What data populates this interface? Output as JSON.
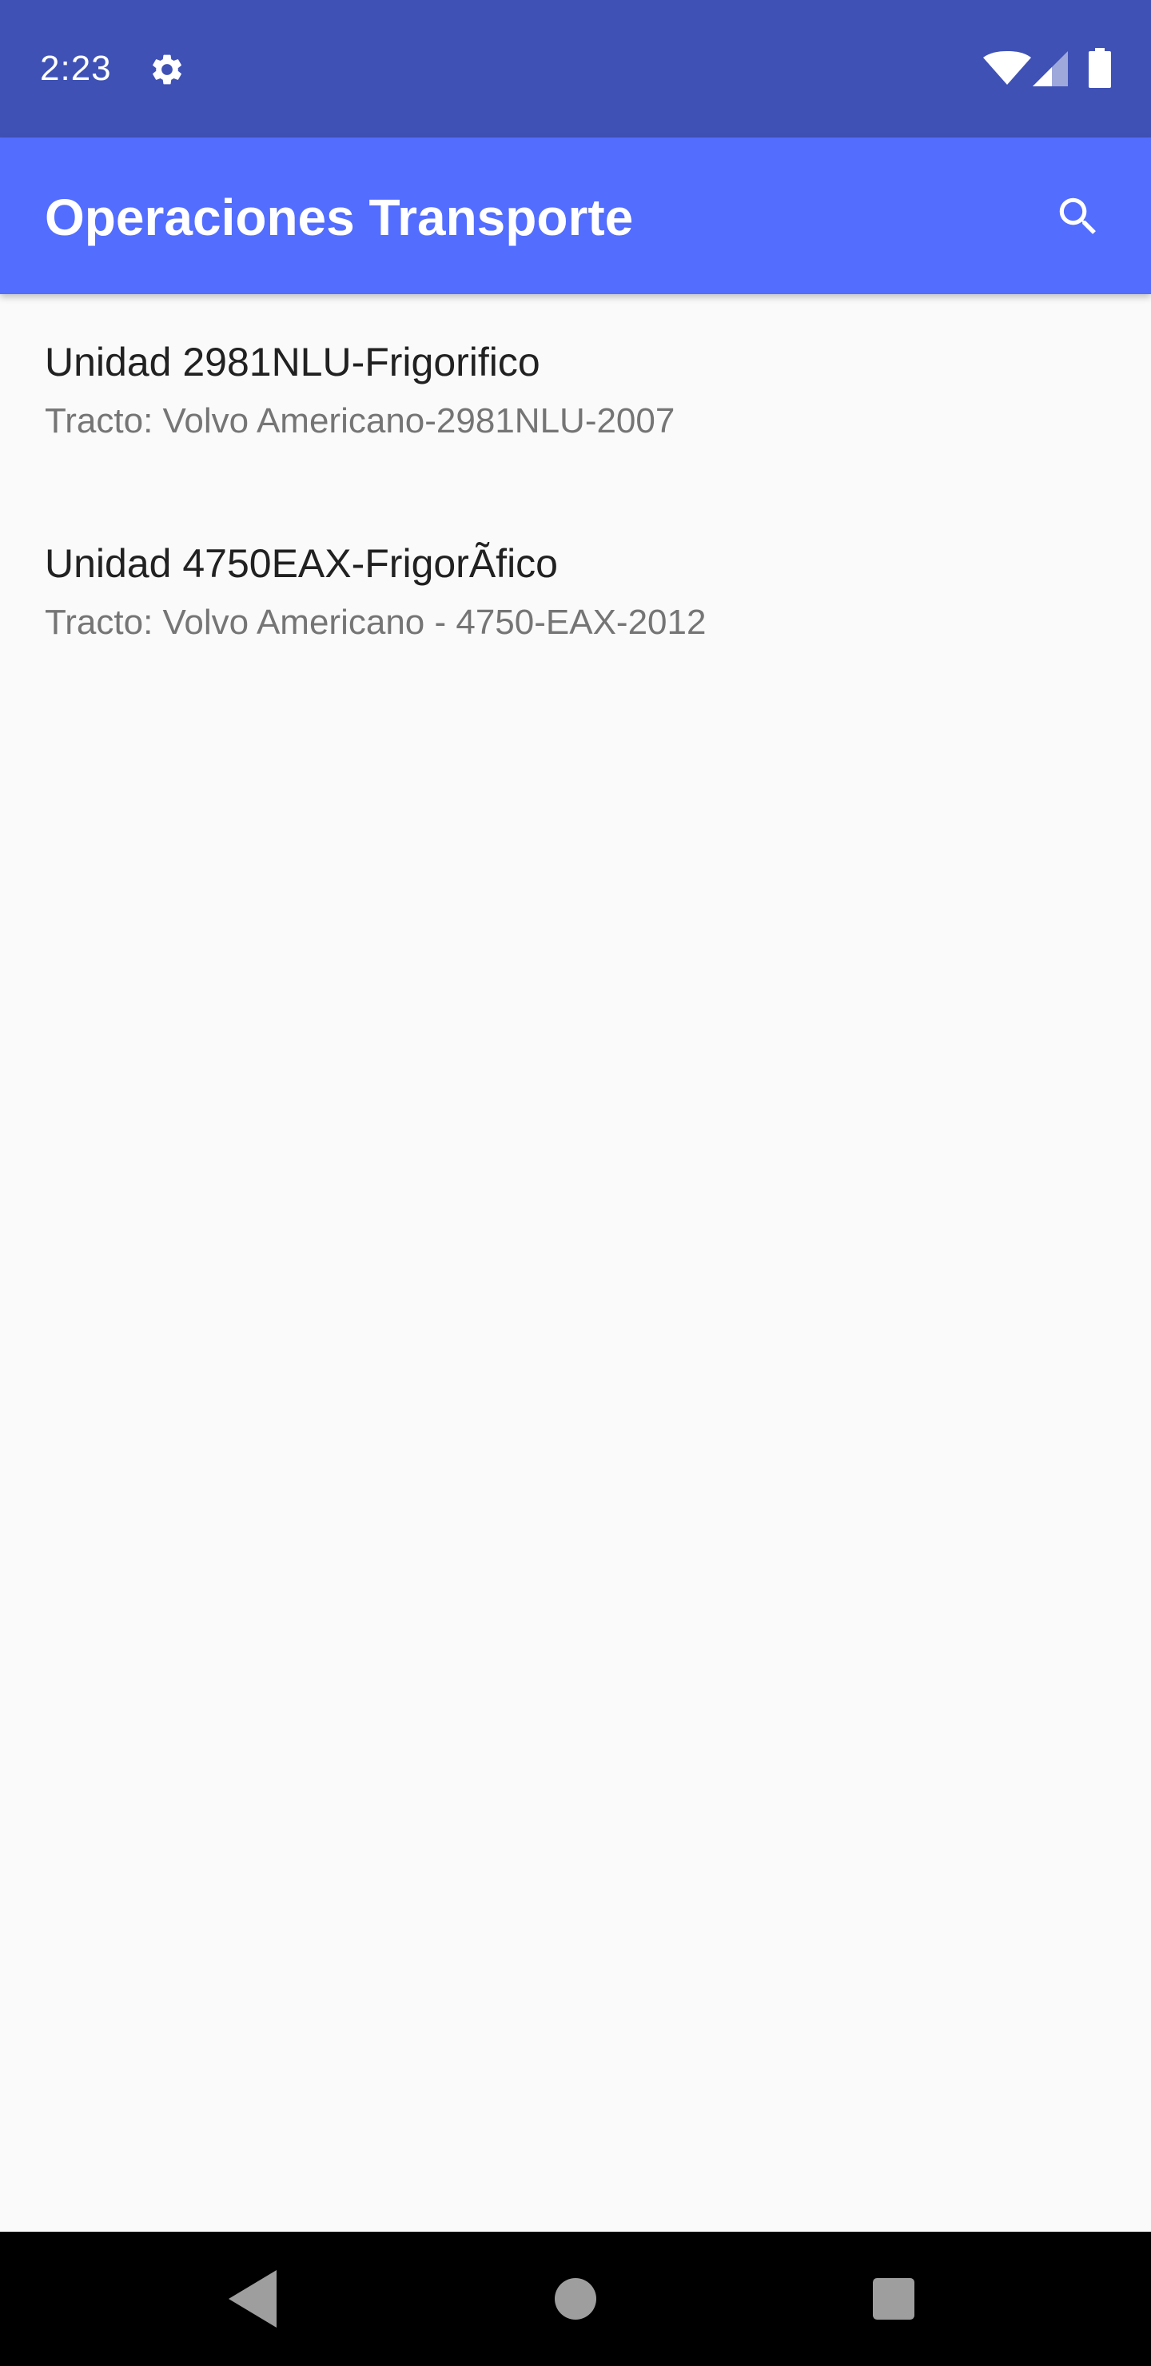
{
  "status_bar": {
    "time": "2:23",
    "icons": [
      "settings-icon",
      "wifi-icon",
      "signal-icon",
      "battery-icon"
    ]
  },
  "app_bar": {
    "title": "Operaciones Transporte",
    "search_icon": "search-icon",
    "background_color": "#536dfe",
    "status_bar_color": "#3f51b5"
  },
  "list": {
    "items": [
      {
        "title": "Unidad 2981NLU-Frigorifico",
        "subtitle": "Tracto: Volvo Americano-2981NLU-2007"
      },
      {
        "title": "Unidad 4750EAX-FrigorÃfico",
        "subtitle": "Tracto: Volvo Americano - 4750-EAX-2012"
      }
    ]
  },
  "nav_bar": {
    "icons": [
      "back-icon",
      "home-icon",
      "recents-icon"
    ]
  }
}
